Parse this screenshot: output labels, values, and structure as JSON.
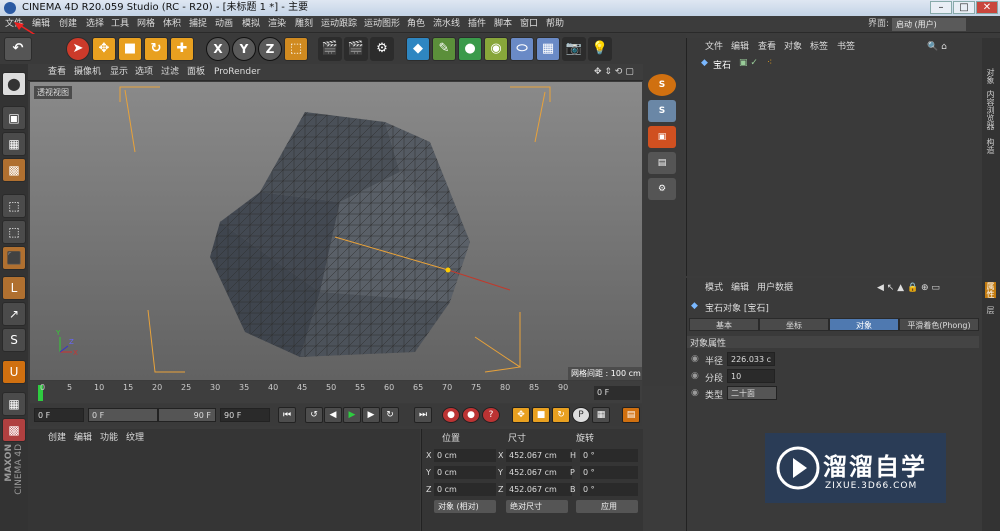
{
  "window": {
    "title": "CINEMA 4D R20.059 Studio (RC - R20) - [未标题 1 *] - 主要",
    "min": "–",
    "max": "□",
    "close": "✕"
  },
  "menubar": {
    "items": [
      "文件",
      "编辑",
      "创建",
      "选择",
      "工具",
      "网格",
      "体积",
      "捕捉",
      "动画",
      "模拟",
      "渲染",
      "雕刻",
      "运动跟踪",
      "运动图形",
      "角色",
      "流水线",
      "插件",
      "脚本",
      "窗口",
      "帮助"
    ],
    "layout_label": "界面:",
    "layout_value": "启动 (用户)"
  },
  "toolbar": {
    "x": "X",
    "y": "Y",
    "z": "Z"
  },
  "viewport": {
    "menu": [
      "查看",
      "摄像机",
      "显示",
      "选项",
      "过滤",
      "面板",
      "ProRender"
    ],
    "label": "透视视图",
    "grid_spacing": "网格间距 : 100 cm",
    "axis": {
      "x": "X",
      "y": "Y",
      "z": "Z"
    }
  },
  "timeline": {
    "ticks": [
      "0",
      "5",
      "10",
      "15",
      "20",
      "25",
      "30",
      "35",
      "40",
      "45",
      "50",
      "55",
      "60",
      "65",
      "70",
      "75",
      "80",
      "85",
      "90"
    ],
    "current_frame": "0 F",
    "start_field": "0 F",
    "range_start": "0 F",
    "range_end": "90 F",
    "end_field": "90 F"
  },
  "material_panel": {
    "menu": [
      "创建",
      "编辑",
      "功能",
      "纹理"
    ]
  },
  "coord_panel": {
    "headers": {
      "pos": "位置",
      "size": "尺寸",
      "rot": "旋转"
    },
    "rows": [
      {
        "axis": "X",
        "pos": "0 cm",
        "size_axis": "X",
        "size": "452.067 cm",
        "rot_axis": "H",
        "rot": "0 °"
      },
      {
        "axis": "Y",
        "pos": "0 cm",
        "size_axis": "Y",
        "size": "452.067 cm",
        "rot_axis": "P",
        "rot": "0 °"
      },
      {
        "axis": "Z",
        "pos": "0 cm",
        "size_axis": "Z",
        "size": "452.067 cm",
        "rot_axis": "B",
        "rot": "0 °"
      }
    ],
    "mode_select": "对象 (相对)",
    "size_select": "绝对尺寸",
    "apply": "应用"
  },
  "object_manager": {
    "menu": [
      "文件",
      "编辑",
      "查看",
      "对象",
      "标签",
      "书签"
    ],
    "object_name": "宝石"
  },
  "attributes": {
    "menu": [
      "模式",
      "编辑",
      "用户数据"
    ],
    "title": "宝石对象 [宝石]",
    "tabs": [
      "基本",
      "坐标",
      "对象",
      "平滑着色(Phong)"
    ],
    "active_tab": "对象",
    "section": "对象属性",
    "fields": [
      {
        "label": "半径",
        "value": "226.033 c"
      },
      {
        "label": "分段",
        "value": "10"
      },
      {
        "label": "类型",
        "value": "二十面"
      }
    ]
  },
  "side_tabs": [
    "对象",
    "内容浏览器",
    "构造",
    "属性",
    "层"
  ],
  "watermark": {
    "brand": "溜溜自学",
    "url": "ZIXUE.3D66.COM"
  },
  "maxon": {
    "line1": "MAXON",
    "line2": "CINEMA 4D"
  },
  "colors": {
    "accent": "#4f79b0",
    "guide": "#e8a23a",
    "selected_tool": "#f0a020"
  }
}
